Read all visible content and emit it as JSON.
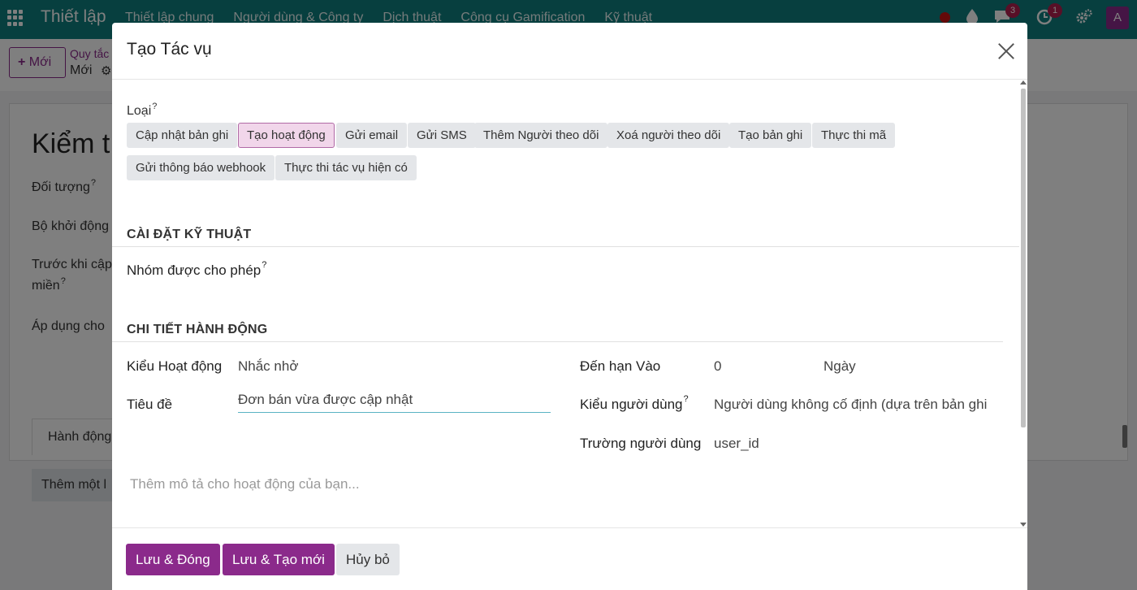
{
  "app": {
    "brand": "Thiết lập",
    "menu": [
      "Thiết lập chung",
      "Người dùng & Công ty",
      "Dịch thuật",
      "Công cụ Gamification",
      "Kỹ thuật"
    ],
    "badges": {
      "messages": "3",
      "activities": "1"
    },
    "avatar_letter": "A"
  },
  "control_panel": {
    "new_button": "Mới",
    "breadcrumb_parent": "Quy tắc",
    "breadcrumb_current": "Mới"
  },
  "form": {
    "title": "Kiểm t",
    "labels": [
      "Đối tượng",
      "Bộ khởi động",
      "Trước khi cập",
      "miền",
      "Áp dụng cho"
    ],
    "tab": "Hành động",
    "add_line": "Thêm một l"
  },
  "modal": {
    "title": "Tạo Tác vụ",
    "type_label": "Loại",
    "types": [
      {
        "label": "Cập nhật bản ghi",
        "active": false
      },
      {
        "label": "Tạo hoạt động",
        "active": true
      },
      {
        "label": "Gửi email",
        "active": false
      },
      {
        "label": "Gửi SMS",
        "active": false
      },
      {
        "label": "Thêm Người theo dõi",
        "active": false
      },
      {
        "label": "Xoá người theo dõi",
        "active": false
      },
      {
        "label": "Tạo bản ghi",
        "active": false
      },
      {
        "label": "Thực thi mã",
        "active": false
      },
      {
        "label": "Gửi thông báo webhook",
        "active": false
      },
      {
        "label": "Thực thi tác vụ hiện có",
        "active": false
      }
    ],
    "technical_section": "CÀI ĐẶT KỸ THUẬT",
    "allowed_groups_label": "Nhóm được cho phép",
    "action_details_section": "CHI TIẾT HÀNH ĐỘNG",
    "activity_type_label": "Kiểu Hoạt động",
    "activity_type_value": "Nhắc nhở",
    "summary_label": "Tiêu đề",
    "summary_value": "Đơn bán vừa được cập nhật",
    "due_label": "Đến hạn Vào",
    "due_value": "0",
    "due_unit": "Ngày",
    "user_type_label": "Kiểu người dùng",
    "user_type_value": "Người dùng không cố định (dựa trên bản ghi",
    "user_field_label": "Trường người dùng",
    "user_field_value": "user_id",
    "description_placeholder": "Thêm mô tả cho hoạt động của bạn...",
    "buttons": {
      "save_close": "Lưu & Đóng",
      "save_new": "Lưu & Tạo mới",
      "cancel": "Hủy bỏ"
    }
  }
}
